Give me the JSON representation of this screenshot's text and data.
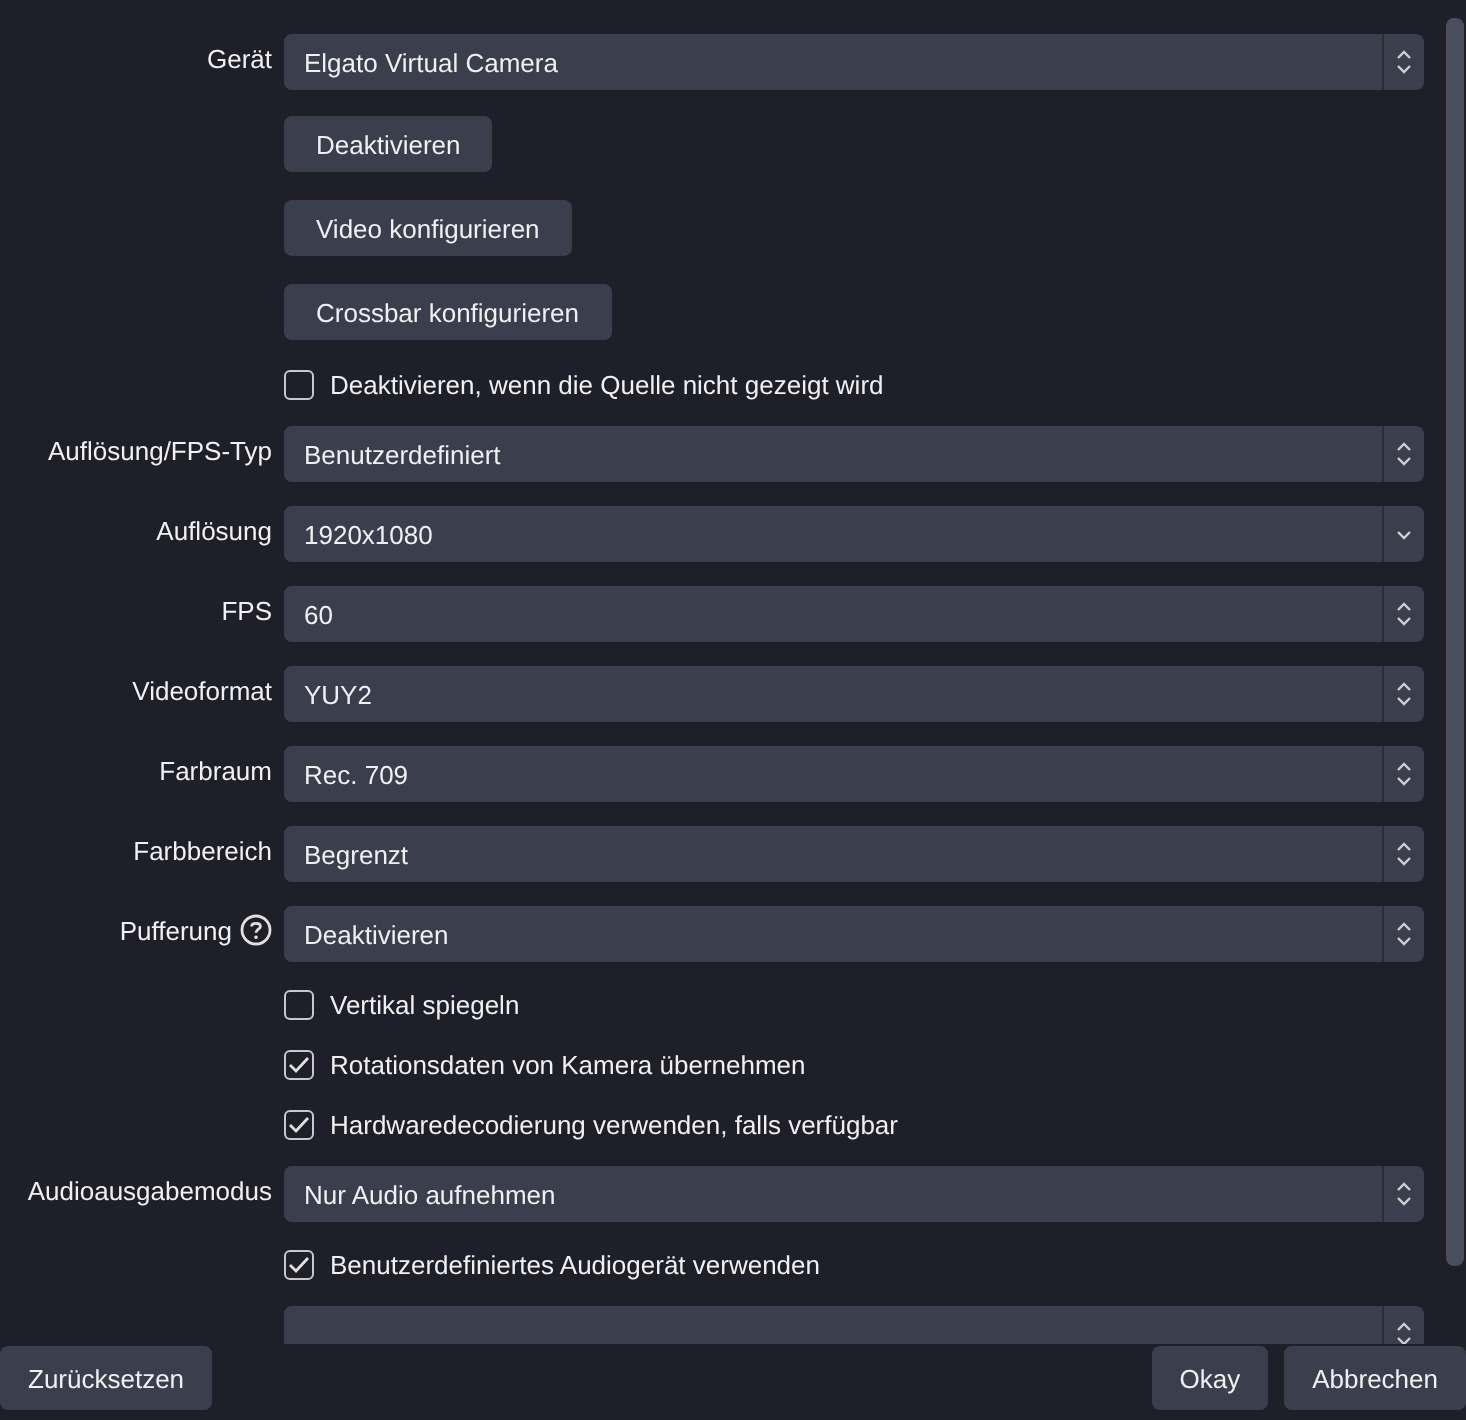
{
  "properties": [
    {
      "kind": "combo",
      "label": "Gerät",
      "value": "Elgato Virtual Camera"
    },
    {
      "kind": "button",
      "text": "Deaktivieren"
    },
    {
      "kind": "button",
      "text": "Video konfigurieren"
    },
    {
      "kind": "button",
      "text": "Crossbar konfigurieren"
    },
    {
      "kind": "checkbox",
      "text": "Deaktivieren, wenn die Quelle nicht gezeigt wird",
      "checked": false
    },
    {
      "kind": "combo",
      "label": "Auflösung/FPS-Typ",
      "value": "Benutzerdefiniert"
    },
    {
      "kind": "editable_combo",
      "label": "Auflösung",
      "value": "1920x1080"
    },
    {
      "kind": "combo",
      "label": "FPS",
      "value": "60"
    },
    {
      "kind": "combo",
      "label": "Videoformat",
      "value": "YUY2"
    },
    {
      "kind": "combo",
      "label": "Farbraum",
      "value": "Rec. 709"
    },
    {
      "kind": "combo",
      "label": "Farbbereich",
      "value": "Begrenzt"
    },
    {
      "kind": "combo",
      "label": "Pufferung",
      "help": true,
      "value": "Deaktivieren"
    },
    {
      "kind": "checkbox",
      "text": "Vertikal spiegeln",
      "checked": false
    },
    {
      "kind": "checkbox",
      "text": "Rotationsdaten von Kamera übernehmen",
      "checked": true
    },
    {
      "kind": "checkbox",
      "text": "Hardwaredecodierung verwenden, falls verfügbar",
      "checked": true
    },
    {
      "kind": "combo",
      "label": "Audioausgabemodus",
      "value": "Nur Audio aufnehmen"
    },
    {
      "kind": "checkbox",
      "text": "Benutzerdefiniertes Audiogerät verwenden",
      "checked": true
    },
    {
      "kind": "combo"
    }
  ],
  "footer": {
    "reset": "Zurücksetzen",
    "ok": "Okay",
    "cancel": "Abbrechen"
  }
}
